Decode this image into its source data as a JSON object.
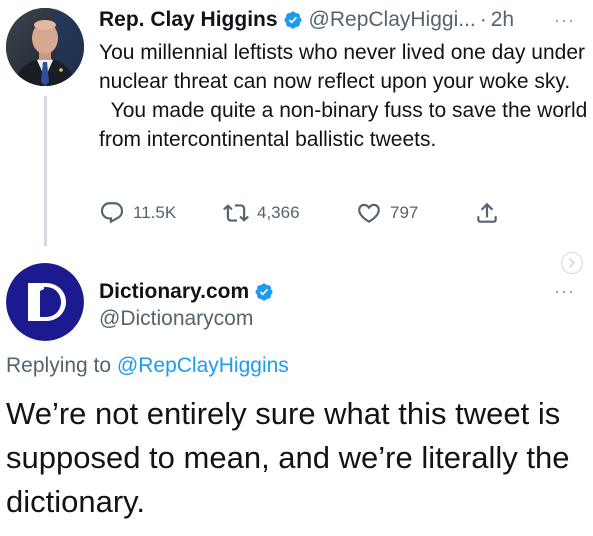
{
  "original_tweet": {
    "author": {
      "name": "Rep. Clay Higgins",
      "handle": "@RepClayHiggi...",
      "verified": true,
      "avatar": "portrait-photo"
    },
    "separator": "·",
    "time": "2h",
    "more": "···",
    "text": "You millennial leftists who never lived one day under nuclear threat can now reflect upon your woke sky.\n  You made quite a non-binary fuss to save the world from intercontinental ballistic tweets.",
    "stats": {
      "replies": "11.5K",
      "retweets": "4,366",
      "likes": "797"
    }
  },
  "reply_tweet": {
    "author": {
      "name": "Dictionary.com",
      "handle": "@Dictionarycom",
      "verified": true,
      "avatar": "dictionary-logo"
    },
    "more": "···",
    "replying_prefix": "Replying to ",
    "replying_to": "@RepClayHiggins",
    "text": "We’re not entirely sure what this tweet is supposed to mean, and we’re literally the dictionary."
  },
  "colors": {
    "accent": "#1d9bf0",
    "text": "#0f1419",
    "secondary": "#536471",
    "thread_line": "#cfd9de",
    "dictionary_brand": "#1b1a8e"
  },
  "icons": [
    "verified-badge-icon",
    "reply-icon",
    "retweet-icon",
    "like-icon",
    "share-icon",
    "chevron-right-icon",
    "more-icon"
  ]
}
